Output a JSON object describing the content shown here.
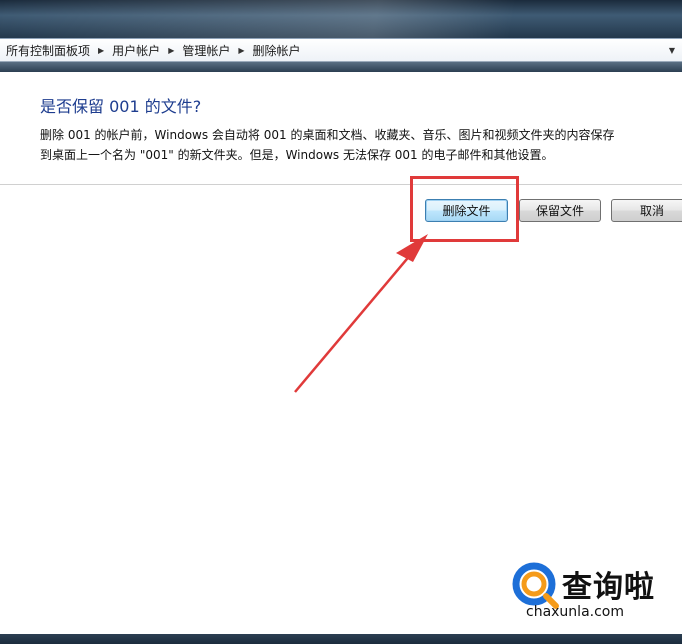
{
  "breadcrumb": {
    "items": [
      "所有控制面板项",
      "用户帐户",
      "管理帐户",
      "删除帐户"
    ]
  },
  "dialog": {
    "title": "是否保留 001 的文件?",
    "description_line1": "删除 001 的帐户前，Windows 会自动将 001 的桌面和文档、收藏夹、音乐、图片和视频文件夹的内容保存",
    "description_line2": "到桌面上一个名为 \"001\" 的新文件夹。但是，Windows 无法保存 001 的电子邮件和其他设置。"
  },
  "buttons": {
    "delete_files": "删除文件",
    "keep_files": "保留文件",
    "cancel": "取消"
  },
  "annotation": {
    "color": "#e03a3a"
  },
  "watermark": {
    "name": "查询啦",
    "domain": "chaxunla.com"
  }
}
